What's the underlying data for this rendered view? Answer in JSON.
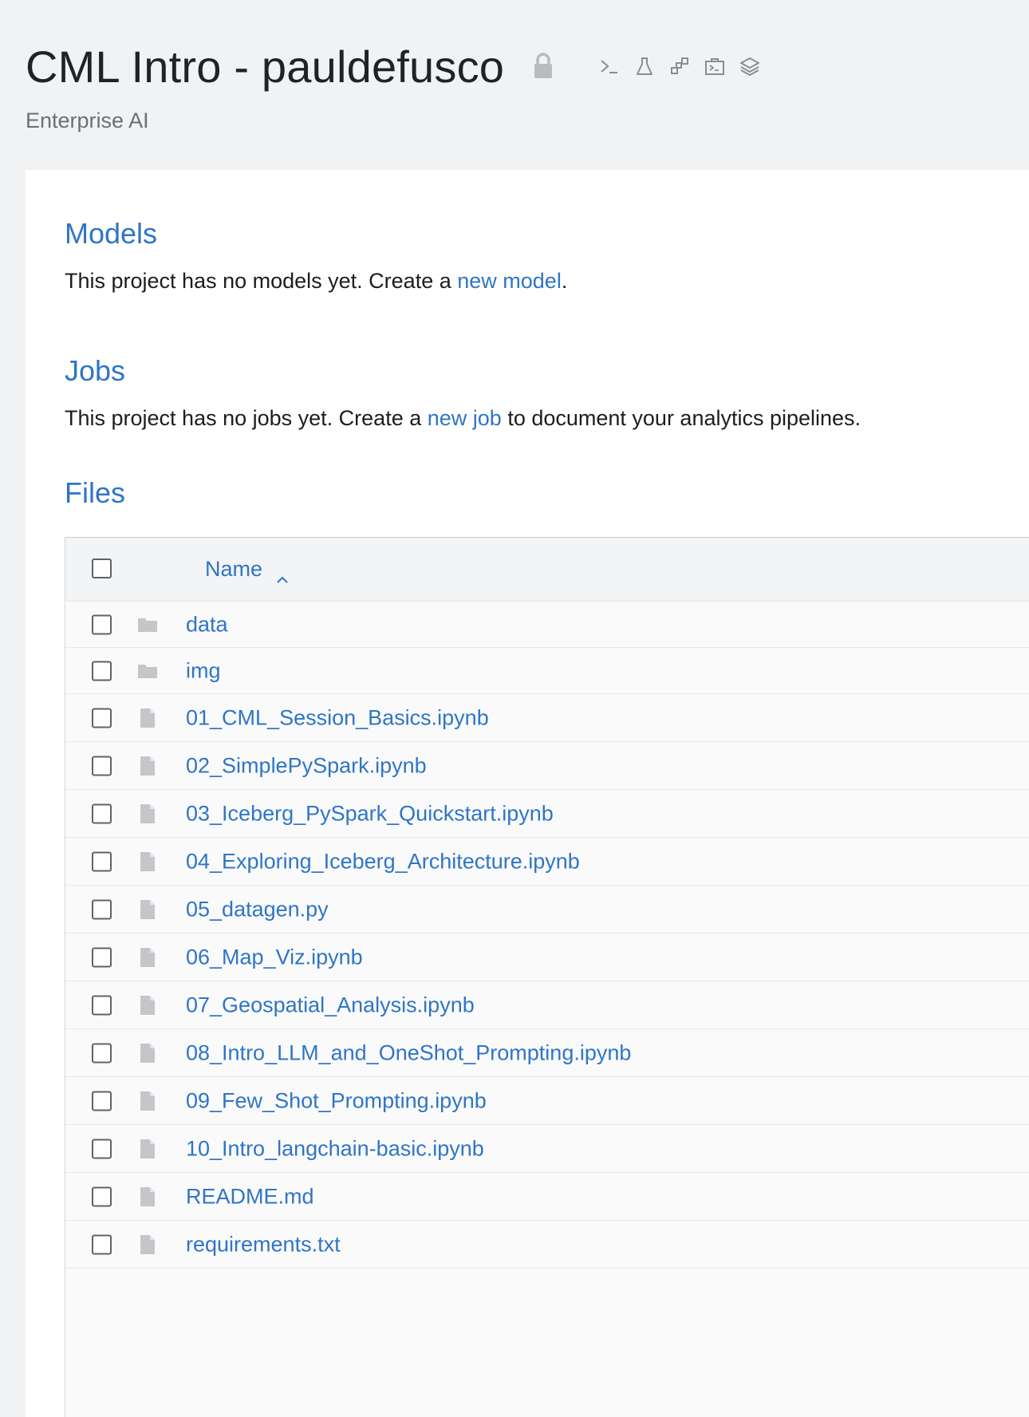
{
  "header": {
    "title": "CML Intro - pauldefusco",
    "subtitle": "Enterprise AI",
    "lock_icon": "lock-icon",
    "toolbar_icons": [
      "terminal-icon",
      "flask-icon",
      "network-icon",
      "briefcase-terminal-icon",
      "layers-icon"
    ]
  },
  "models": {
    "title": "Models",
    "text_before": "This project has no models yet. Create a ",
    "link": "new model",
    "text_after": "."
  },
  "jobs": {
    "title": "Jobs",
    "text_before": "This project has no jobs yet. Create a ",
    "link": "new job",
    "text_after": " to document your analytics pipelines."
  },
  "files": {
    "title": "Files",
    "column_name": "Name",
    "sort": "ascending",
    "items": [
      {
        "name": "data",
        "type": "folder"
      },
      {
        "name": "img",
        "type": "folder"
      },
      {
        "name": "01_CML_Session_Basics.ipynb",
        "type": "file"
      },
      {
        "name": "02_SimplePySpark.ipynb",
        "type": "file"
      },
      {
        "name": "03_Iceberg_PySpark_Quickstart.ipynb",
        "type": "file"
      },
      {
        "name": "04_Exploring_Iceberg_Architecture.ipynb",
        "type": "file"
      },
      {
        "name": "05_datagen.py",
        "type": "file"
      },
      {
        "name": "06_Map_Viz.ipynb",
        "type": "file"
      },
      {
        "name": "07_Geospatial_Analysis.ipynb",
        "type": "file"
      },
      {
        "name": "08_Intro_LLM_and_OneShot_Prompting.ipynb",
        "type": "file"
      },
      {
        "name": "09_Few_Shot_Prompting.ipynb",
        "type": "file"
      },
      {
        "name": "10_Intro_langchain-basic.ipynb",
        "type": "file"
      },
      {
        "name": "README.md",
        "type": "file"
      },
      {
        "name": "requirements.txt",
        "type": "file"
      }
    ]
  },
  "colors": {
    "accent": "#2f75c6",
    "background": "#f1f2f4",
    "card": "#ffffff",
    "icon_gray": "#c4c6ca"
  }
}
